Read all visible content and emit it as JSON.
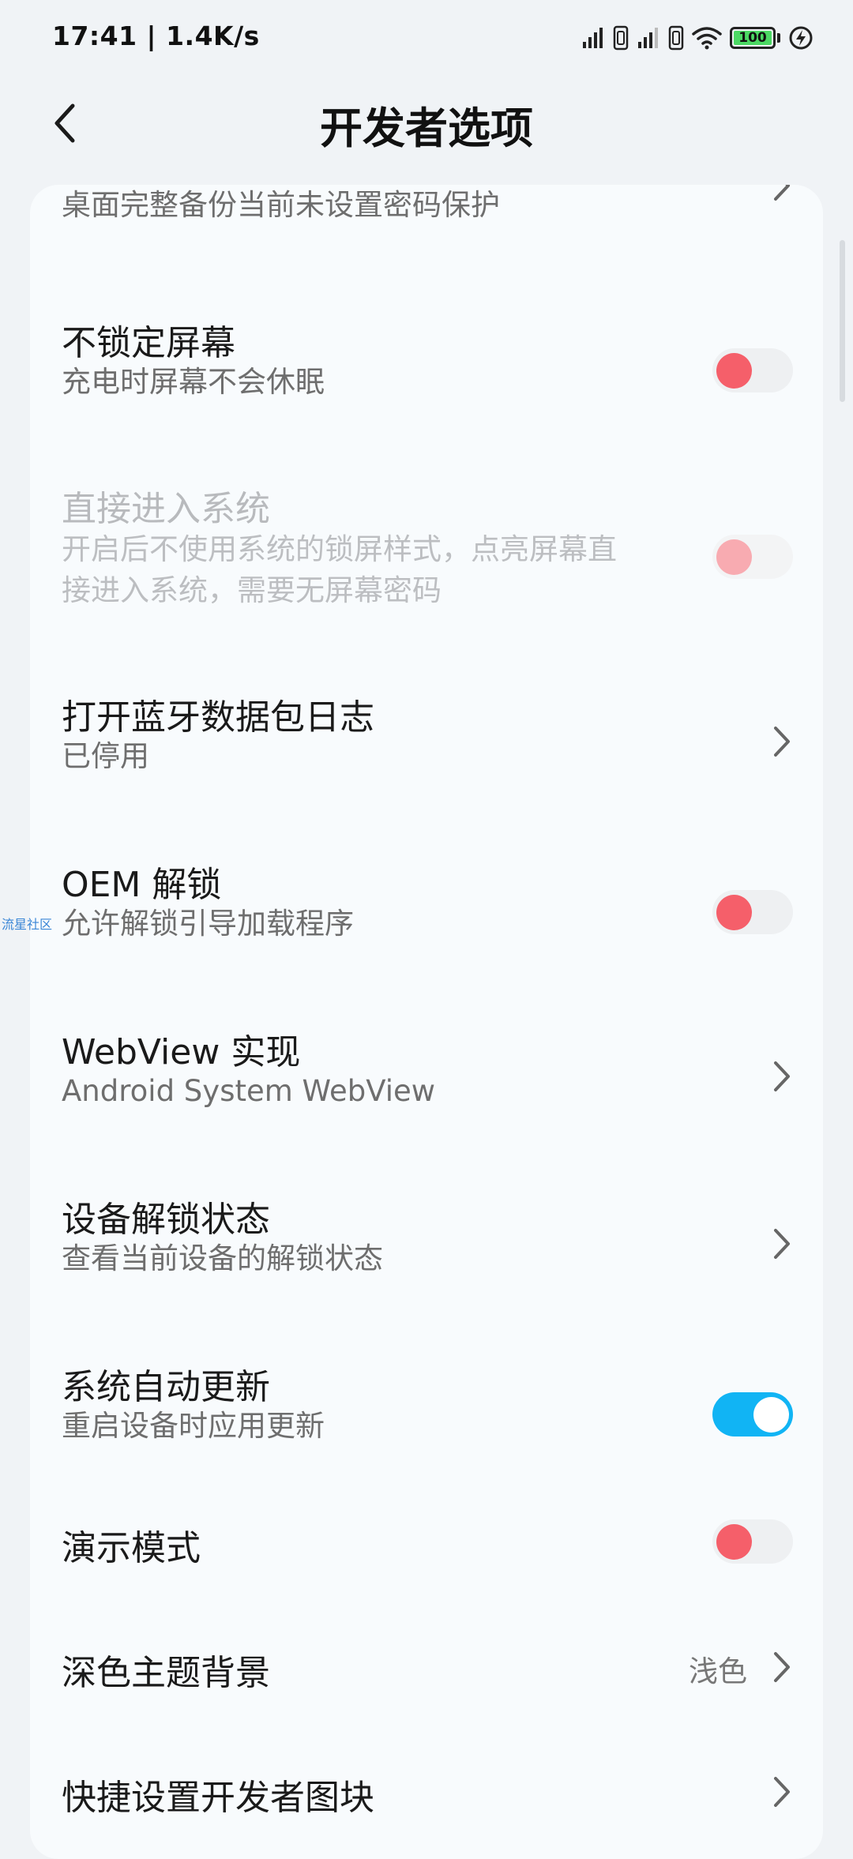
{
  "status_bar": {
    "time_speed": "17:41 | 1.4K/s",
    "battery_level": "100",
    "icons": [
      "signal-icon",
      "hd-icon",
      "signal-icon",
      "hd-icon",
      "wifi-icon",
      "battery-icon",
      "charging-icon"
    ]
  },
  "header": {
    "back_icon": "back-arrow-icon",
    "title": "开发者选项"
  },
  "items": [
    {
      "title": "",
      "subtitle": "桌面完整备份当前未设置密码保护",
      "control": "chevron"
    },
    {
      "title": "不锁定屏幕",
      "subtitle": "充电时屏幕不会休眠",
      "control": "toggle",
      "checked": false
    },
    {
      "title": "直接进入系统",
      "subtitle_line1": "开启后不使用系统的锁屏样式，点亮屏幕直",
      "subtitle_line2": "接进入系统，需要无屏幕密码",
      "control": "toggle",
      "checked": false,
      "disabled": true
    },
    {
      "title": "打开蓝牙数据包日志",
      "subtitle": "已停用",
      "control": "chevron"
    },
    {
      "title": "OEM 解锁",
      "subtitle": "允许解锁引导加载程序",
      "control": "toggle",
      "checked": false
    },
    {
      "title": "WebView 实现",
      "subtitle": "Android System WebView",
      "control": "chevron"
    },
    {
      "title": "设备解锁状态",
      "subtitle": "查看当前设备的解锁状态",
      "control": "chevron"
    },
    {
      "title": "系统自动更新",
      "subtitle": "重启设备时应用更新",
      "control": "toggle",
      "checked": true
    },
    {
      "title": "演示模式",
      "control": "toggle",
      "checked": false
    },
    {
      "title": "深色主题背景",
      "value": "浅色",
      "control": "chevron"
    },
    {
      "title": "快捷设置开发者图块",
      "control": "chevron"
    }
  ],
  "watermark": "流星社区",
  "colors": {
    "toggle_off_knob": "#f55f6a",
    "toggle_on_track": "#11b4f4",
    "background": "#f0f3f6",
    "card": "#f8fbfd"
  }
}
